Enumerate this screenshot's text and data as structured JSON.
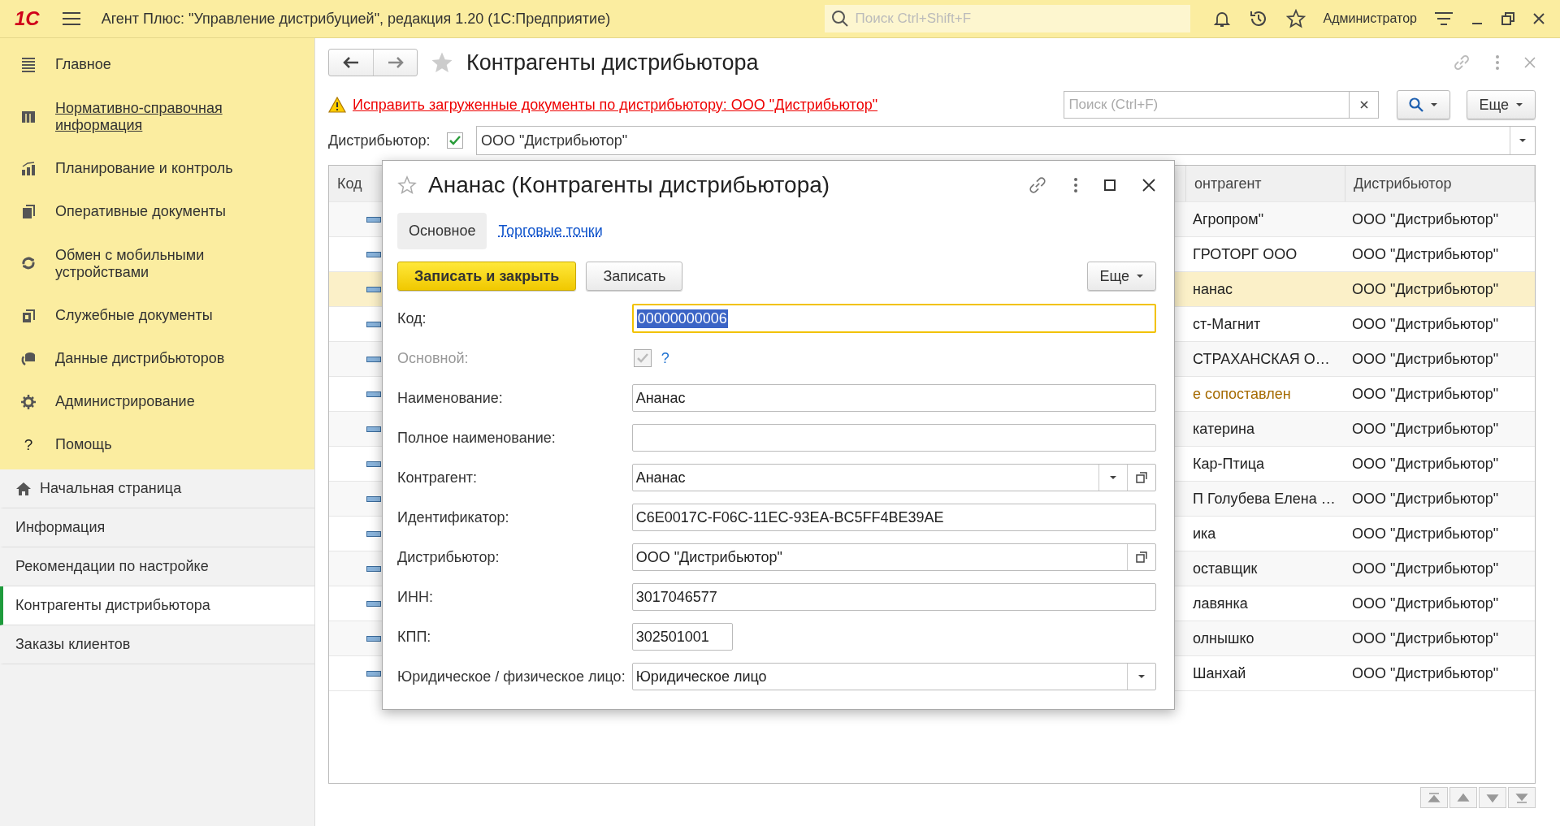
{
  "app_bar": {
    "logo": "1С",
    "title": "Агент Плюс: \"Управление дистрибуцией\", редакция 1.20  (1С:Предприятие)",
    "search": {
      "placeholder": "Поиск Ctrl+Shift+F"
    },
    "user": "Администратор"
  },
  "sections": [
    {
      "label": "Главное",
      "hovered": false
    },
    {
      "label": "Нормативно-справочная информация",
      "hovered": true
    },
    {
      "label": "Планирование и контроль",
      "hovered": false
    },
    {
      "label": "Оперативные документы",
      "hovered": false
    },
    {
      "label": "Обмен с мобильными устройствами",
      "hovered": false
    },
    {
      "label": "Служебные документы",
      "hovered": false
    },
    {
      "label": "Данные дистрибьюторов",
      "hovered": false
    },
    {
      "label": "Администрирование",
      "hovered": false
    },
    {
      "label": "Помощь",
      "hovered": false,
      "glyph": "?"
    }
  ],
  "open_windows": [
    {
      "label": "Начальная страница",
      "kind": "home",
      "selected": false
    },
    {
      "label": "Информация",
      "kind": "plain",
      "selected": false
    },
    {
      "label": "Рекомендации по настройке",
      "kind": "plain",
      "selected": false
    },
    {
      "label": "Контрагенты дистрибьютора",
      "kind": "plain",
      "selected": true
    },
    {
      "label": "Заказы клиентов",
      "kind": "plain",
      "selected": false
    }
  ],
  "page": {
    "title": "Контрагенты дистрибьютора",
    "warning_link": "Исправить загруженные документы по дистрибьютору: ООО \"Дистрибьютор\"",
    "search": {
      "placeholder": "Поиск (Ctrl+F)"
    },
    "more_button": "Еще",
    "filter": {
      "label": "Дистрибьютор:",
      "checked": true,
      "value": "ООО \"Дистрибьютор\""
    },
    "table": {
      "columns": [
        "Код",
        "онтрагент",
        "Дистрибьютор"
      ],
      "rows": [
        {
          "column_2": "Агропром\"",
          "column_3": "ООО \"Дистрибьютор\"",
          "selected": false,
          "unmatched": false
        },
        {
          "column_2": "ГРОТОРГ ООО",
          "column_3": "ООО \"Дистрибьютор\"",
          "selected": false,
          "unmatched": false
        },
        {
          "column_2": "нанас",
          "column_3": "ООО \"Дистрибьютор\"",
          "selected": true,
          "unmatched": false
        },
        {
          "column_2": "ст-Магнит",
          "column_3": "ООО \"Дистрибьютор\"",
          "selected": false,
          "unmatched": false
        },
        {
          "column_2": "СТРАХАНСКАЯ О…",
          "column_3": "ООО \"Дистрибьютор\"",
          "selected": false,
          "unmatched": false
        },
        {
          "column_2": "е сопоставлен",
          "column_3": "ООО \"Дистрибьютор\"",
          "selected": false,
          "unmatched": true
        },
        {
          "column_2": "катерина",
          "column_3": "ООО \"Дистрибьютор\"",
          "selected": false,
          "unmatched": false
        },
        {
          "column_2": "Кар-Птица",
          "column_3": "ООО \"Дистрибьютор\"",
          "selected": false,
          "unmatched": false
        },
        {
          "column_2": "П Голубева Елена …",
          "column_3": "ООО \"Дистрибьютор\"",
          "selected": false,
          "unmatched": false
        },
        {
          "column_2": "ика",
          "column_3": "ООО \"Дистрибьютор\"",
          "selected": false,
          "unmatched": false
        },
        {
          "column_2": "оставщик",
          "column_3": "ООО \"Дистрибьютор\"",
          "selected": false,
          "unmatched": false
        },
        {
          "column_2": "лавянка",
          "column_3": "ООО \"Дистрибьютор\"",
          "selected": false,
          "unmatched": false
        },
        {
          "column_2": "олнышко",
          "column_3": "ООО \"Дистрибьютор\"",
          "selected": false,
          "unmatched": false
        },
        {
          "column_2": "Шанхай",
          "column_3": "ООО \"Дистрибьютор\"",
          "selected": false,
          "unmatched": false
        }
      ]
    }
  },
  "dialog": {
    "title": "Ананас (Контрагенты дистрибьютора)",
    "tabs": [
      {
        "label": "Основное",
        "selected": true
      },
      {
        "label": "Торговые точки",
        "selected": false
      }
    ],
    "buttons": [
      {
        "label": "Записать и закрыть",
        "kind": "primary"
      },
      {
        "label": "Записать",
        "kind": "default"
      }
    ],
    "more_button": "Еще",
    "fields": [
      {
        "label": "Код:",
        "kind": "text",
        "value": "00000000006",
        "focused": true,
        "disabled": false
      },
      {
        "label": "Основной:",
        "kind": "checkbox",
        "checked": true,
        "help": "?",
        "disabled": true
      },
      {
        "label": "Наименование:",
        "kind": "text",
        "value": "Ананас",
        "disabled": false
      },
      {
        "label": "Полное наименование:",
        "kind": "text",
        "disabled": false
      },
      {
        "label": "Контрагент:",
        "kind": "select",
        "value": "Ананас",
        "disabled": false
      },
      {
        "label": "Идентификатор:",
        "kind": "text",
        "value": "C6E0017C-F06C-11EC-93EA-BC5FF4BE39AE",
        "disabled": false
      },
      {
        "label": "Дистрибьютор:",
        "kind": "ref",
        "value": "ООО \"Дистрибьютор\"",
        "disabled": false
      },
      {
        "label": "ИНН:",
        "kind": "text",
        "value": "3017046577",
        "disabled": false
      },
      {
        "label": "КПП:",
        "kind": "short",
        "value": "302501001",
        "disabled": false
      },
      {
        "label": "Юридическое / физическое лицо:",
        "kind": "dropdown",
        "value": "Юридическое лицо",
        "disabled": false
      }
    ]
  }
}
